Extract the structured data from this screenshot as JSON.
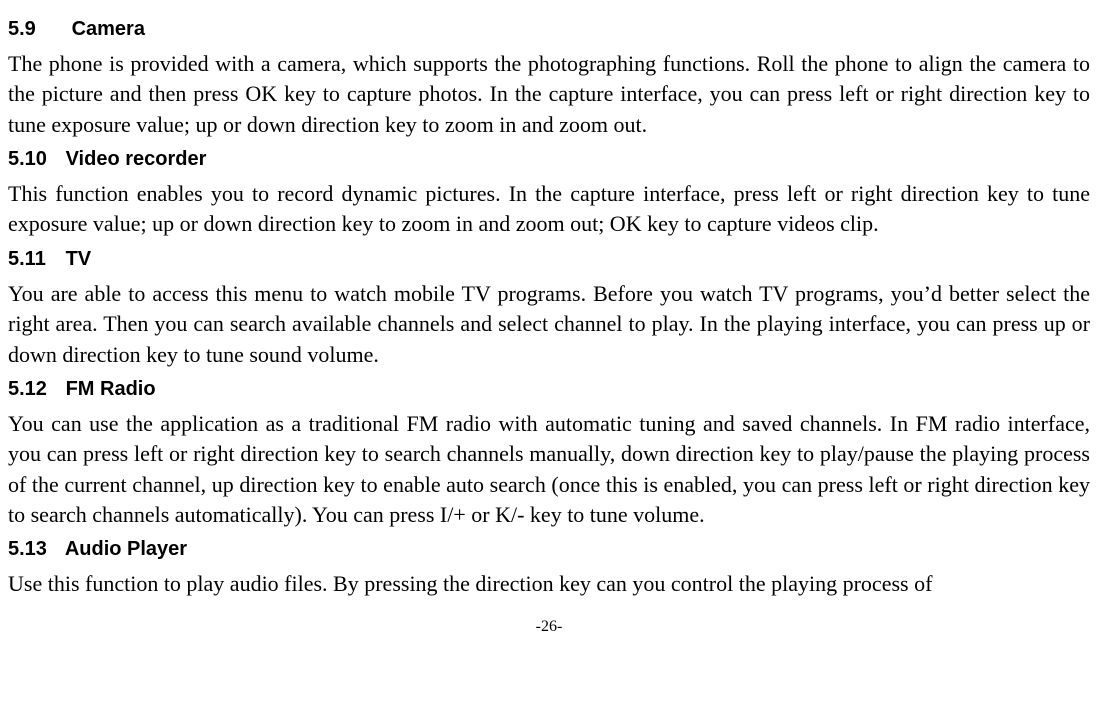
{
  "sections": {
    "s59": {
      "number": "5.9",
      "title": "Camera",
      "body": "The phone is provided with a camera, which supports the photographing functions. Roll the phone to align the camera to the picture and then press OK key to capture photos. In the capture interface, you can press left or right direction key to tune exposure value; up or down direction key to zoom in and zoom out."
    },
    "s510": {
      "number": "5.10",
      "title": "Video recorder",
      "body": "This function enables you to record dynamic pictures. In the capture interface, press left or right direction key to tune exposure value; up or down direction key to zoom in and zoom out; OK key to capture videos clip."
    },
    "s511": {
      "number": "5.11",
      "title": "TV",
      "body": "You are able to access this menu to watch mobile TV programs. Before you watch TV programs, you’d better select the right area. Then you can search available channels and select channel to play. In the playing interface, you can press up or down direction key to tune sound volume."
    },
    "s512": {
      "number": "5.12",
      "title": "FM Radio",
      "body": "You can use the application as a traditional FM radio with automatic tuning and saved channels. In FM radio interface, you can press left or right direction key to search channels manually, down direction key to play/pause the playing process of the current channel, up direction key to enable auto search (once this is enabled, you can press left or right direction key to search channels automatically). You can press I/+ or K/- key to tune volume."
    },
    "s513": {
      "number": "5.13",
      "title": "Audio Player",
      "body": "Use this function to play audio files. By pressing the direction key can you control the playing process of"
    }
  },
  "page_number": "-26-"
}
